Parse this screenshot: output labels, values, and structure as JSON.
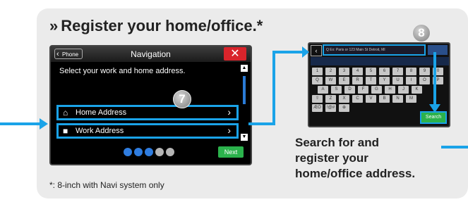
{
  "title": {
    "chevron": "»",
    "text": "Register your home/office.*"
  },
  "screen1": {
    "back_label": "Phone",
    "title": "Navigation",
    "close": "✕",
    "subtitle": "Select your work and home address.",
    "rows": [
      {
        "icon": "home-icon",
        "label": "Home Address"
      },
      {
        "icon": "briefcase-icon",
        "label": "Work Address"
      }
    ],
    "next_label": "Next",
    "step_badge": "7",
    "dot_colors": [
      "#2f7de0",
      "#2f7de0",
      "#2f7de0",
      "#b5b5b5",
      "#b5b5b5"
    ]
  },
  "screen2": {
    "search_placeholder": "Q  Ex: Paris or 123 Main St Detroit, MI",
    "step_badge": "8",
    "keys_row1": [
      "1",
      "2",
      "3",
      "4",
      "5",
      "6",
      "7",
      "8",
      "9",
      "0"
    ],
    "keys_row2": [
      "Q",
      "W",
      "E",
      "R",
      "T",
      "Y",
      "U",
      "I",
      "O",
      "P"
    ],
    "keys_row3": [
      "A",
      "S",
      "D",
      "F",
      "G",
      "H",
      "J",
      "K"
    ],
    "keys_row4": [
      "⇧",
      "Z",
      "X",
      "C",
      "V",
      "B",
      "N",
      "M"
    ],
    "keys_row5": [
      "ÆÖ",
      "!@#",
      "⊕"
    ],
    "search_button": "Search"
  },
  "caption": {
    "line1": "Search for and",
    "line2": "register your",
    "line3": "home/office address."
  },
  "footnote": "*: 8-inch with Navi system only",
  "colors": {
    "accent": "#1aa3e8",
    "panel": "#ebebeb",
    "next": "#2bb24c",
    "close": "#d9242b"
  }
}
